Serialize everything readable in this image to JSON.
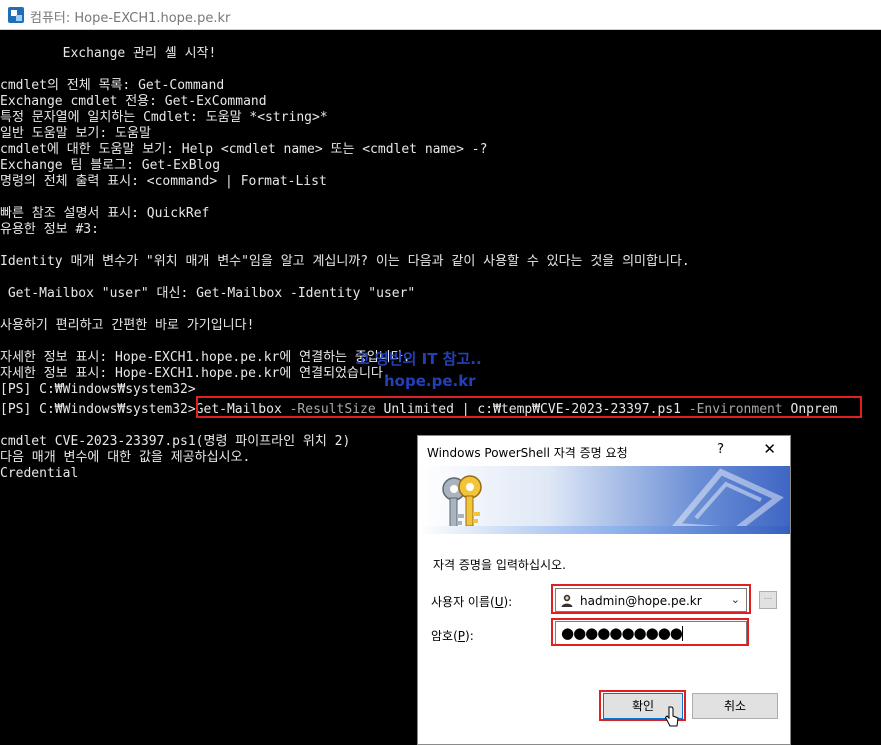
{
  "window": {
    "title": "컴퓨터: Hope-EXCH1.hope.pe.kr"
  },
  "console": {
    "lines": [
      "        Exchange 관리 셸 시작!",
      "",
      "cmdlet의 전체 목록: Get-Command",
      "Exchange cmdlet 전용: Get-ExCommand",
      "특정 문자열에 일치하는 Cmdlet: 도움말 *<string>*",
      "일반 도움말 보기: 도움말",
      "cmdlet에 대한 도움말 보기: Help <cmdlet name> 또는 <cmdlet name> -?",
      "Exchange 팀 블로그: Get-ExBlog",
      "명령의 전체 출력 표시: <command> | Format-List",
      "",
      "빠른 참조 설명서 표시: QuickRef",
      "유용한 정보 #3:",
      "",
      "Identity 매개 변수가 \"위치 매개 변수\"임을 알고 계십니까? 이는 다음과 같이 사용할 수 있다는 것을 의미합니다.",
      "",
      " Get-Mailbox \"user\" 대신: Get-Mailbox -Identity \"user\"",
      "",
      "사용하기 편리하고 간편한 바로 가기입니다!",
      "",
      "자세한 정보 표시: Hope-EXCH1.hope.pe.kr에 연결하는 중입니다.",
      "자세한 정보 표시: Hope-EXCH1.hope.pe.kr에 연결되었습니다.",
      "[PS] C:₩Windows₩system32>"
    ],
    "prompt": "[PS] C:₩Windows₩system32>",
    "command": {
      "cmd": "Get-Mailbox",
      "param1": " -ResultSize",
      "value1": " Unlimited | c:₩temp₩CVE-2023-23397.ps1",
      "param2": " -Environment",
      "value2": " Onprem"
    },
    "after_lines": [
      "",
      "cmdlet CVE-2023-23397.ps1(명령 파이프라인 위치 2)",
      "다음 매개 변수에 대한 값을 제공하십시오.",
      "Credential"
    ]
  },
  "watermark": {
    "line1": "고 영빈의 IT 참고..",
    "line2": "hope.pe.kr"
  },
  "dialog": {
    "title": "Windows PowerShell 자격 증명 요청",
    "help": "?",
    "close": "✕",
    "message": "자격 증명을 입력하십시오.",
    "user_label": "사용자 이름",
    "user_key": "U",
    "password_label": "암호",
    "password_key": "P",
    "username": "hadmin@hope.pe.kr",
    "password_mask": "●●●●●●●●●●",
    "browse": "...",
    "ok": "확인",
    "cancel": "취소"
  },
  "colors": {
    "highlight": "#e02020",
    "console_bg": "#000000",
    "watermark": "#2746c9"
  }
}
